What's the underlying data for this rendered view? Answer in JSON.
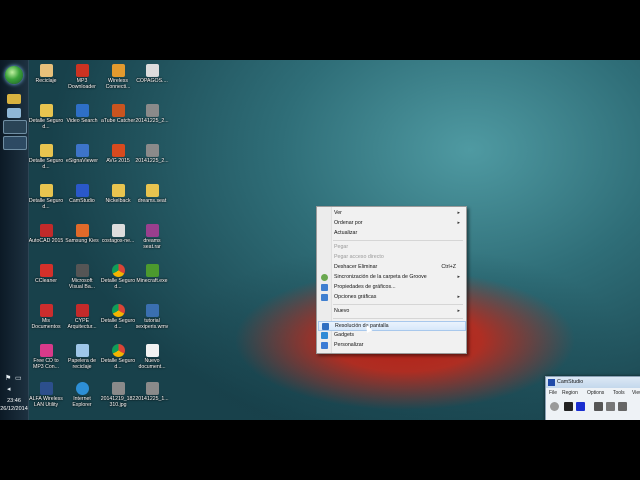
{
  "taskbar": {
    "start_icon": "windows-orb-icon",
    "clock_time": "23:46",
    "clock_date": "26/12/2014"
  },
  "desktop_icons": [
    {
      "label": "Reciclaje",
      "icon": "recycle-bin-icon",
      "color": "#e8c07a"
    },
    {
      "label": "MP3 Downloader",
      "icon": "app-icon",
      "color": "#cc3322"
    },
    {
      "label": "Wireless Connecti...",
      "icon": "wifi-icon",
      "color": "#e39a2e"
    },
    {
      "label": "COPAGOS....",
      "icon": "document-icon",
      "color": "#dddddd"
    },
    {
      "label": "Detalle Seguro d...",
      "icon": "folder-icon",
      "color": "#e8c44f"
    },
    {
      "label": "Video Search",
      "icon": "app-icon",
      "color": "#2e6fc7"
    },
    {
      "label": "aTube Catcher",
      "icon": "app-icon",
      "color": "#c9541f"
    },
    {
      "label": "20141225_2...",
      "icon": "image-icon",
      "color": "#8a8a8a"
    },
    {
      "label": "Detalle Seguro d...",
      "icon": "folder-icon",
      "color": "#e8c44f"
    },
    {
      "label": "eSignaViewer",
      "icon": "app-icon",
      "color": "#3d74c9"
    },
    {
      "label": "AVG 2015",
      "icon": "app-icon",
      "color": "#d84a1e"
    },
    {
      "label": "20141225_2...",
      "icon": "image-icon",
      "color": "#8a8a8a"
    },
    {
      "label": "Detalle Seguro d...",
      "icon": "folder-icon",
      "color": "#e8c44f"
    },
    {
      "label": "CamStudio",
      "icon": "app-icon",
      "color": "#2a58c9"
    },
    {
      "label": "Nickelback",
      "icon": "folder-icon",
      "color": "#e8c44f"
    },
    {
      "label": "dreams.seat",
      "icon": "folder-icon",
      "color": "#e8c44f"
    },
    {
      "label": "AutoCAD 2015",
      "icon": "app-icon",
      "color": "#c22a2a"
    },
    {
      "label": "Samsung Kies",
      "icon": "app-icon",
      "color": "#e06a2a"
    },
    {
      "label": "costagos-ne...",
      "icon": "document-icon",
      "color": "#dddddd"
    },
    {
      "label": "dreams seat.rar",
      "icon": "archive-icon",
      "color": "#9b3f8e"
    },
    {
      "label": "CCleaner",
      "icon": "app-icon",
      "color": "#d4302a"
    },
    {
      "label": "Microsoft Visual Ba...",
      "icon": "app-icon",
      "color": "#555555"
    },
    {
      "label": "Detalle Seguro d...",
      "icon": "chrome-icon",
      "color": "#4aa04a"
    },
    {
      "label": "Minecraft.exe",
      "icon": "app-icon",
      "color": "#4c9a2e"
    },
    {
      "label": "Mis Documentos",
      "icon": "app-icon",
      "color": "#cc2d2d"
    },
    {
      "label": "CYPE Arquitectur...",
      "icon": "app-icon",
      "color": "#c42a2a"
    },
    {
      "label": "Detalle Seguro d...",
      "icon": "chrome-icon",
      "color": "#4aa04a"
    },
    {
      "label": "tutorial sexiperis.wmv",
      "icon": "video-icon",
      "color": "#3a6fb0"
    },
    {
      "label": "Free CD to MP3 Con...",
      "icon": "app-icon",
      "color": "#d83a8a"
    },
    {
      "label": "Papelera de reciclaje",
      "icon": "recycle-bin-icon",
      "color": "#9ec6e8"
    },
    {
      "label": "Detalle Seguro d...",
      "icon": "chrome-icon",
      "color": "#4aa04a"
    },
    {
      "label": "Nuevo document...",
      "icon": "document-icon",
      "color": "#f2f2f2"
    },
    {
      "label": "ALFA Wireless LAN Utility",
      "icon": "app-icon",
      "color": "#2c4f8c"
    },
    {
      "label": "Internet Explorer",
      "icon": "ie-icon",
      "color": "#2d8fd6"
    },
    {
      "label": "20141219_182 310.jpg",
      "icon": "image-icon",
      "color": "#8a8a8a"
    },
    {
      "label": "20141225_1...",
      "icon": "image-icon",
      "color": "#8a8a8a"
    }
  ],
  "context_menu": {
    "items": [
      {
        "label": "Ver",
        "submenu": true
      },
      {
        "label": "Ordenar por",
        "submenu": true
      },
      {
        "label": "Actualizar"
      },
      {
        "label": "Pegar",
        "disabled": true
      },
      {
        "label": "Pegar acceso directo",
        "disabled": true
      },
      {
        "label": "Deshacer Eliminar",
        "shortcut": "Ctrl+Z"
      },
      {
        "label": "Sincronización de la carpeta de Groove",
        "submenu": true,
        "icon": "groove-icon"
      },
      {
        "label": "Propiedades de gráficos...",
        "icon": "graphics-icon"
      },
      {
        "label": "Opciones gráficas",
        "submenu": true,
        "icon": "graphics-options-icon"
      },
      {
        "label": "Nuevo",
        "submenu": true
      },
      {
        "label": "Resolución de pantalla",
        "icon": "display-icon",
        "highlighted": true
      },
      {
        "label": "Gadgets",
        "icon": "gadgets-icon"
      },
      {
        "label": "Personalizar",
        "icon": "personalize-icon"
      }
    ]
  },
  "camstudio": {
    "title": "CamStudio",
    "menu": [
      "File",
      "Region",
      "Options",
      "Tools",
      "View"
    ]
  },
  "colors": {
    "menu_bg": "#f1f1f1",
    "highlight": "#d7e8fa",
    "taskbar": "#16283a"
  }
}
